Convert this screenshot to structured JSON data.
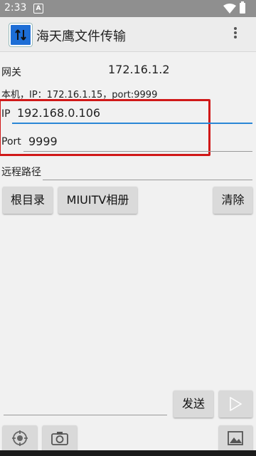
{
  "status_bar": {
    "time": "2:33",
    "notification_icon": "A"
  },
  "app_bar": {
    "title": "海天鹰文件传输",
    "icon": "transfer-arrows-icon",
    "menu_icon": "overflow-menu-icon"
  },
  "gateway": {
    "label": "网关",
    "value": "172.16.1.2"
  },
  "local": {
    "text": "本机，IP：172.16.1.15，port:9999"
  },
  "ip_field": {
    "label": "IP",
    "value": "192.168.0.106"
  },
  "port_field": {
    "label": "Port",
    "value": "9999"
  },
  "remote_path": {
    "label": "远程路径",
    "value": ""
  },
  "buttons": {
    "root": "根目录",
    "miuitv": "MIUITV相册",
    "clear": "清除",
    "send": "发送"
  },
  "message": {
    "value": ""
  },
  "colors": {
    "highlight": "#d01818",
    "accent": "#2a87d6",
    "app_icon": "#1d6ed6"
  }
}
